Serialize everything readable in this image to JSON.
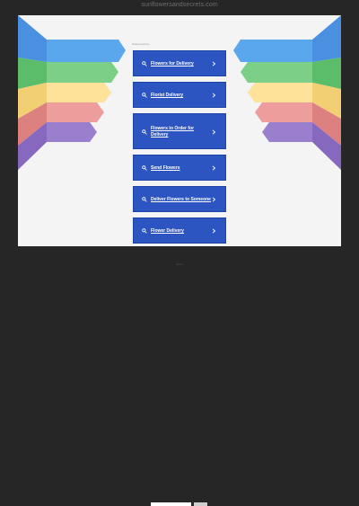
{
  "header": {
    "domain": "sunflowersandsecrets.com"
  },
  "main": {
    "sponsored_label": "Related searches",
    "links": [
      {
        "label": "Flowers for Delivery"
      },
      {
        "label": "Florist Delivery"
      },
      {
        "label": "Flowers to Order for Delivery"
      },
      {
        "label": "Send Flowers"
      },
      {
        "label": "Deliver Flowers to Someone"
      },
      {
        "label": "Flower Delivery"
      }
    ]
  },
  "footer": {
    "text": "Privacy"
  },
  "colors": {
    "page_bg": "#262626",
    "stage_bg": "#f4f4f4",
    "link_bg": "#2d55c1",
    "arrow_blue": "#5aa7ee",
    "arrow_green": "#7ccf86",
    "arrow_yellow": "#ffe29a",
    "arrow_red": "#ee9d9d",
    "arrow_purple": "#9a7fcf"
  },
  "icons": {
    "link_icon": "search-icon",
    "link_arrow": "chevron-right-icon"
  }
}
